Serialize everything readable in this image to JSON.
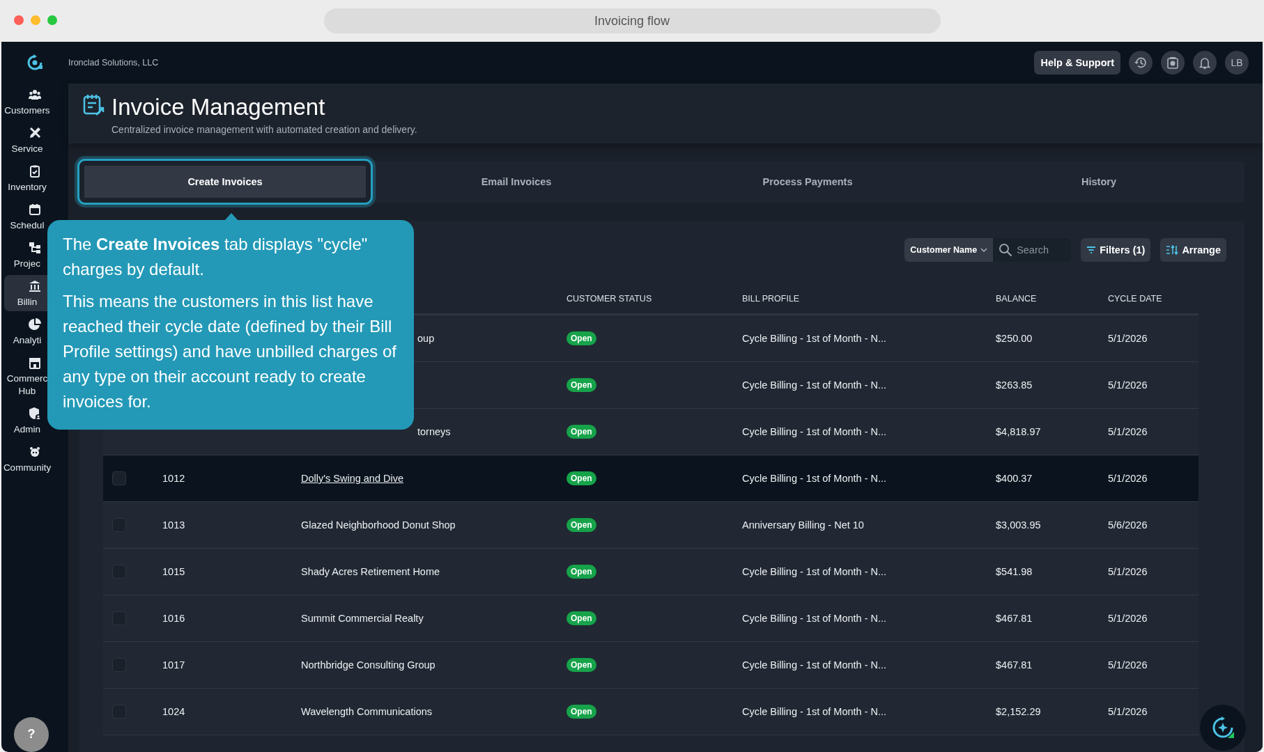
{
  "window": {
    "title": "Invoicing flow"
  },
  "company": "Ironclad Solutions, LLC",
  "topbar": {
    "help": "Help & Support",
    "avatar": "LB"
  },
  "sidebar": {
    "items": [
      {
        "label": "Customers",
        "selected": false
      },
      {
        "label": "Service",
        "selected": false
      },
      {
        "label": "Inventory",
        "selected": false
      },
      {
        "label": "Schedul",
        "selected": false
      },
      {
        "label": "Projec",
        "selected": false
      },
      {
        "label": "Billin",
        "selected": true
      },
      {
        "label": "Analyti",
        "selected": false
      },
      {
        "label": "Commerc",
        "label2": "Hub",
        "selected": false
      },
      {
        "label": "Admin",
        "selected": false
      },
      {
        "label": "Community",
        "selected": false
      }
    ]
  },
  "header": {
    "title": "Invoice Management",
    "subtitle": "Centralized invoice management with automated creation and delivery."
  },
  "tabs": [
    {
      "label": "Create Invoices",
      "selected": true
    },
    {
      "label": "Email Invoices",
      "selected": false
    },
    {
      "label": "Process Payments",
      "selected": false
    },
    {
      "label": "History",
      "selected": false
    }
  ],
  "toolbar": {
    "search_by": "Customer Name",
    "search": {
      "placeholder": "Search"
    },
    "filters": "Filters (1)",
    "arrange": "Arrange"
  },
  "table": {
    "columns": [
      "CUSTOMER STATUS",
      "BILL PROFILE",
      "BALANCE",
      "CYCLE DATE"
    ],
    "rows": [
      {
        "kind": "covered",
        "name": "oup",
        "status": "Open",
        "bill_profile": "Cycle Billing - 1st of Month - N...",
        "balance": "$250.00",
        "cycle_date": "5/1/2026"
      },
      {
        "kind": "covered",
        "status": "Open",
        "bill_profile": "Cycle Billing - 1st of Month - N...",
        "balance": "$263.85",
        "cycle_date": "5/1/2026"
      },
      {
        "kind": "covered",
        "name": "torneys",
        "status": "Open",
        "bill_profile": "Cycle Billing - 1st of Month - N...",
        "balance": "$4,818.97",
        "cycle_date": "5/1/2026"
      },
      {
        "kind": "full",
        "checked": false,
        "highlighted": true,
        "id": "1012",
        "name": "Dolly's Swing and Dive",
        "status": "Open",
        "bill_profile": "Cycle Billing - 1st of Month - N...",
        "balance": "$400.37",
        "cycle_date": "5/1/2026"
      },
      {
        "kind": "full",
        "checked": false,
        "highlighted": false,
        "id": "1013",
        "name": "Glazed Neighborhood Donut Shop",
        "status": "Open",
        "bill_profile": "Anniversary Billing - Net 10",
        "balance": "$3,003.95",
        "cycle_date": "5/6/2026"
      },
      {
        "kind": "full",
        "checked": false,
        "highlighted": false,
        "id": "1015",
        "name": "Shady Acres Retirement Home",
        "status": "Open",
        "bill_profile": "Cycle Billing - 1st of Month - N...",
        "balance": "$541.98",
        "cycle_date": "5/1/2026"
      },
      {
        "kind": "full",
        "checked": false,
        "highlighted": false,
        "id": "1016",
        "name": "Summit Commercial Realty",
        "status": "Open",
        "bill_profile": "Cycle Billing - 1st of Month - N...",
        "balance": "$467.81",
        "cycle_date": "5/1/2026"
      },
      {
        "kind": "full",
        "checked": false,
        "highlighted": false,
        "id": "1017",
        "name": "Northbridge Consulting Group",
        "status": "Open",
        "bill_profile": "Cycle Billing - 1st of Month - N...",
        "balance": "$467.81",
        "cycle_date": "5/1/2026"
      },
      {
        "kind": "full",
        "checked": false,
        "highlighted": false,
        "id": "1024",
        "name": "Wavelength Communications",
        "status": "Open",
        "bill_profile": "Cycle Billing - 1st of Month - N...",
        "balance": "$2,152.29",
        "cycle_date": "5/1/2026"
      }
    ]
  },
  "tooltip": {
    "paragraphs": [
      "The **Create Invoices** tab displays \"cycle\" charges by default.",
      "This means the customers in this list have reached their cycle date (defined by their Bill Profile settings) and have unbilled charges of any type on their account ready to create invoices for."
    ]
  },
  "help_bubble": "?"
}
